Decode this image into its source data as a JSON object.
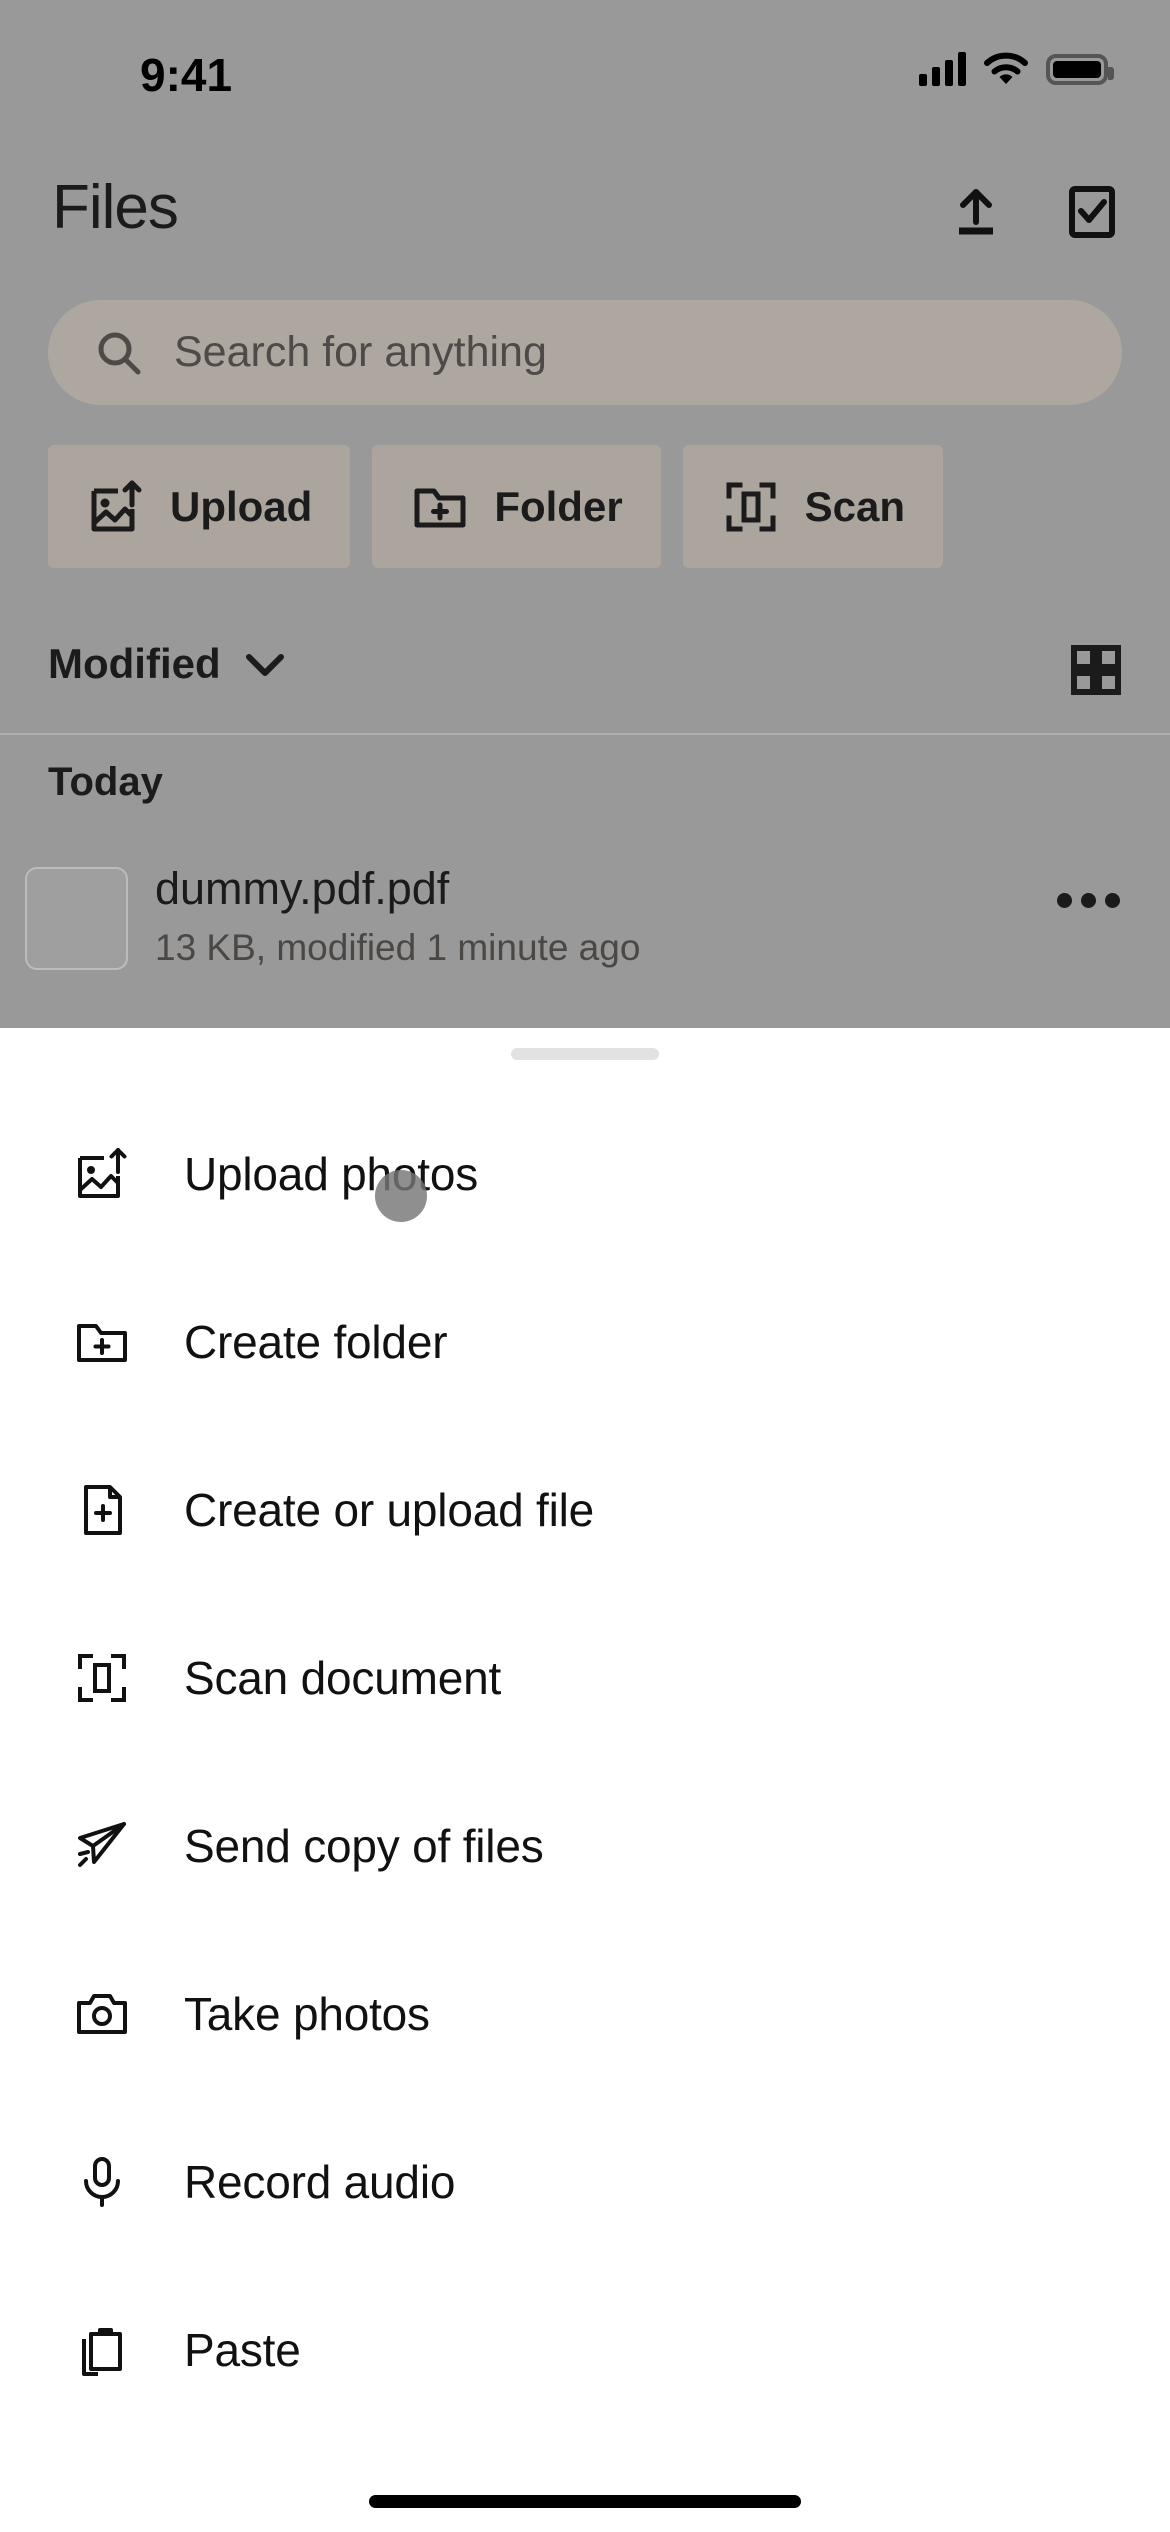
{
  "status_bar": {
    "time": "9:41",
    "icons": [
      "cellular-signal-icon",
      "wifi-icon",
      "battery-icon"
    ]
  },
  "app": {
    "title": "Files",
    "header_actions": [
      {
        "name": "upload-button",
        "icon": "upload-arrow-icon"
      },
      {
        "name": "select-button",
        "icon": "checkbox-checked-icon"
      }
    ],
    "search": {
      "placeholder": "Search for anything",
      "icon": "search-icon"
    },
    "quick_actions": [
      {
        "label": "Upload",
        "icon": "image-upload-icon"
      },
      {
        "label": "Folder",
        "icon": "folder-plus-icon"
      },
      {
        "label": "Scan",
        "icon": "scan-frame-icon"
      }
    ],
    "sort": {
      "label": "Modified",
      "chevron": "chevron-down-icon"
    },
    "view_toggle_icon": "grid-view-icon",
    "sections": [
      {
        "header": "Today",
        "files": [
          {
            "name": "dummy.pdf.pdf",
            "meta": "13 KB, modified 1 minute ago",
            "more_icon": "more-horizontal-icon"
          }
        ]
      }
    ]
  },
  "bottom_sheet": {
    "handle": "drag-handle",
    "items": [
      {
        "label": "Upload photos",
        "icon": "image-upload-icon"
      },
      {
        "label": "Create folder",
        "icon": "folder-plus-icon"
      },
      {
        "label": "Create or upload file",
        "icon": "file-plus-icon"
      },
      {
        "label": "Scan document",
        "icon": "scan-frame-icon"
      },
      {
        "label": "Send copy of files",
        "icon": "paper-plane-icon"
      },
      {
        "label": "Take photos",
        "icon": "camera-icon"
      },
      {
        "label": "Record audio",
        "icon": "microphone-icon"
      },
      {
        "label": "Paste",
        "icon": "clipboard-icon"
      }
    ]
  },
  "colors": {
    "scrim": "#999999",
    "chip_background": "#ABA59D",
    "search_background": "#ADA7A0",
    "sheet_background": "#ffffff",
    "text_primary": "#111111",
    "text_secondary": "#4a4744",
    "touch_indicator": "#767676",
    "handle": "#e2e2e2",
    "home_indicator": "#000000"
  }
}
